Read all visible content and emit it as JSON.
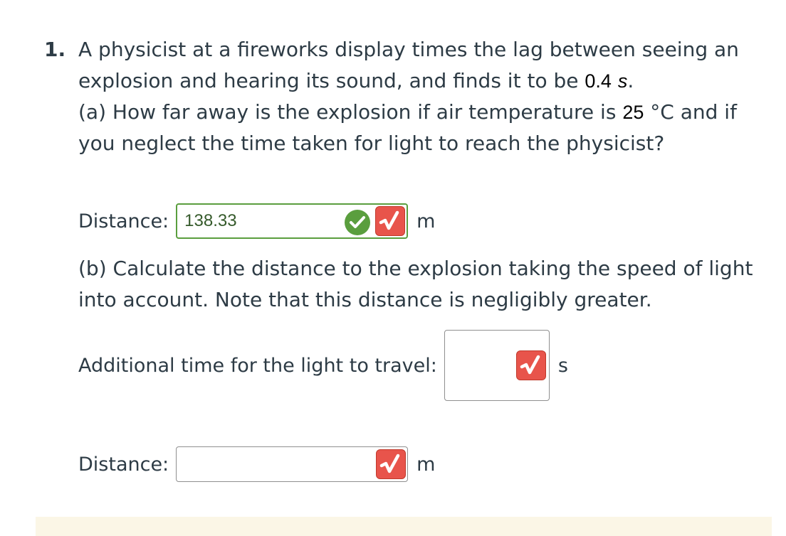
{
  "question": {
    "number": "1.",
    "intro": "A physicist at a fireworks display times the lag between seeing an explosion and hearing its sound, and finds it to be",
    "time_value": "0.4",
    "time_unit": "s",
    "intro_end": ".",
    "part_a_prefix": "(a) How far away is the explosion if air temperature is",
    "temp_value": "25",
    "temp_unit": "°C and if you neglect the time taken for light to reach the physicist?"
  },
  "part_a": {
    "label": "Distance:",
    "value": "138.33",
    "unit": "m",
    "status": "correct"
  },
  "part_b": {
    "text": "(b) Calculate the distance to the explosion taking the speed of light into account. Note that this distance is negligibly greater."
  },
  "additional_time": {
    "label": "Additional time for the light to travel:",
    "value": "",
    "unit": "s"
  },
  "distance_b": {
    "label": "Distance:",
    "value": "",
    "unit": "m"
  },
  "colors": {
    "correct_green": "#5a9e3e",
    "sqrt_button_red": "#e8544b",
    "text": "#2d3b45",
    "footer_bar": "#fbf6e6"
  },
  "icons": [
    "check-circle-icon",
    "square-root-icon"
  ]
}
